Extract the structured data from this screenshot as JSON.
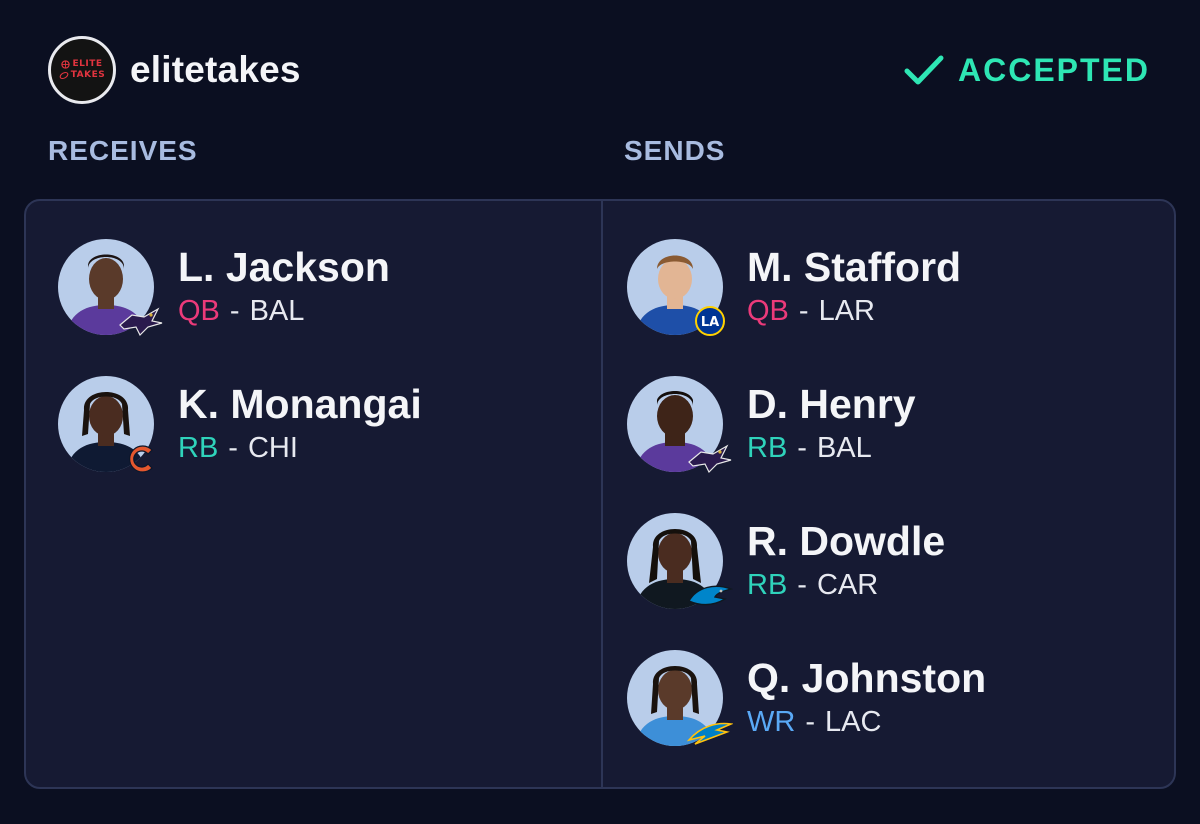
{
  "header": {
    "brand": {
      "line1": "ELITE",
      "line2": "TAKES"
    },
    "username": "elitetakes",
    "status": "ACCEPTED"
  },
  "colors": {
    "background": "#0b0f21",
    "panel": "#161a33",
    "accent_green": "#2ee6b4",
    "section_label": "#a8bbe0",
    "qb": "#ec3a7a",
    "rb": "#2fd3bb",
    "wr": "#5aa9f6"
  },
  "receives": {
    "label": "RECEIVES",
    "players": [
      {
        "name": "L. Jackson",
        "pos": "QB",
        "team": "BAL",
        "team_logo": "ravens-logo-icon"
      },
      {
        "name": "K. Monangai",
        "pos": "RB",
        "team": "CHI",
        "team_logo": "bears-logo-icon"
      }
    ]
  },
  "sends": {
    "label": "SENDS",
    "players": [
      {
        "name": "M. Stafford",
        "pos": "QB",
        "team": "LAR",
        "team_logo": "rams-logo-icon"
      },
      {
        "name": "D. Henry",
        "pos": "RB",
        "team": "BAL",
        "team_logo": "ravens-logo-icon"
      },
      {
        "name": "R. Dowdle",
        "pos": "RB",
        "team": "CAR",
        "team_logo": "panthers-logo-icon"
      },
      {
        "name": "Q. Johnston",
        "pos": "WR",
        "team": "LAC",
        "team_logo": "chargers-logo-icon"
      }
    ]
  },
  "separator": "-"
}
